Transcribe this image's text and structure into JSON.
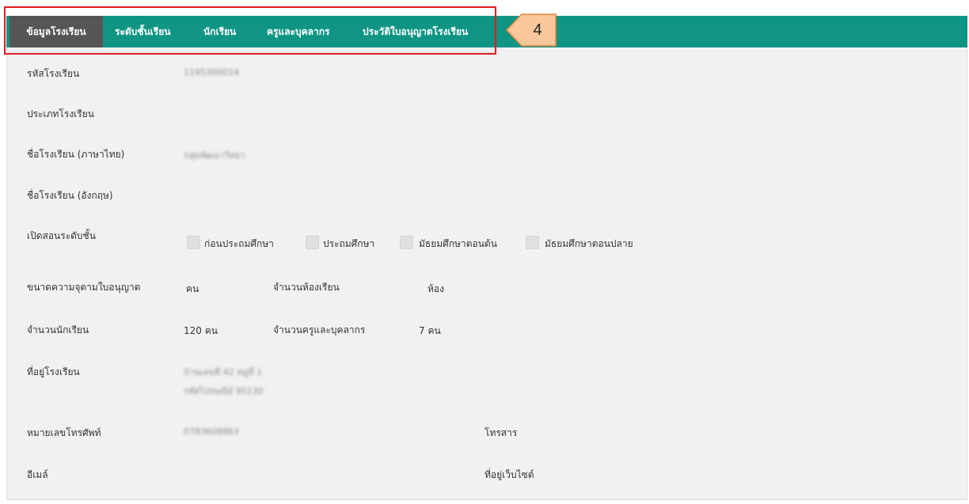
{
  "tabs": [
    {
      "label": "ข้อมูลโรงเรียน",
      "active": true
    },
    {
      "label": "ระดับชั้นเรียน"
    },
    {
      "label": "นักเรียน"
    },
    {
      "label": "ครูและบุคลากร"
    },
    {
      "label": "ประวัติใบอนุญาตโรงเรียน"
    }
  ],
  "callout": {
    "number": "4"
  },
  "colors": {
    "tabbar": "#109584",
    "active_tab": "#555555",
    "highlight": "#e21b23",
    "callout_fill": "#f9c79c",
    "callout_border": "#e8873a"
  },
  "form": {
    "school_code": {
      "label": "รหัสโรงเรียน",
      "value": "1195300014"
    },
    "school_type": {
      "label": "ประเภทโรงเรียน"
    },
    "name_th": {
      "label": "ชื่อโรงเรียน (ภาษาไทย)",
      "value": "กลุ่มพัฒนาวิทยา"
    },
    "name_en": {
      "label": "ชื่อโรงเรียน (อังกฤษ)"
    },
    "levels": {
      "label": "เปิดสอนระดับชั้น",
      "options": [
        "ก่อนประถมศึกษา",
        "ประถมศึกษา",
        "มัธยมศึกษาตอนต้น",
        "มัธยมศึกษาตอนปลาย"
      ]
    },
    "capacity": {
      "label": "ขนาดความจุตามใบอนุญาต",
      "unit": "คน"
    },
    "rooms": {
      "label": "จำนวนห้องเรียน",
      "unit": "ห้อง"
    },
    "students": {
      "label": "จำนวนนักเรียน",
      "value": "120 คน"
    },
    "staff": {
      "label": "จำนวนครูและบุคลากร",
      "value": "7 คน"
    },
    "address": {
      "label": "ที่อยู่โรงเรียน",
      "line1": "บ้านเลขที่ 42 หมู่ที่ 1",
      "line2": "รหัสไปรษณีย์ 95130"
    },
    "phone": {
      "label": "หมายเลขโทรศัพท์",
      "value": "0783608863"
    },
    "fax": {
      "label": "โทรสาร"
    },
    "email": {
      "label": "อีเมล์"
    },
    "website": {
      "label": "ที่อยู่เว็บไซต์"
    }
  }
}
